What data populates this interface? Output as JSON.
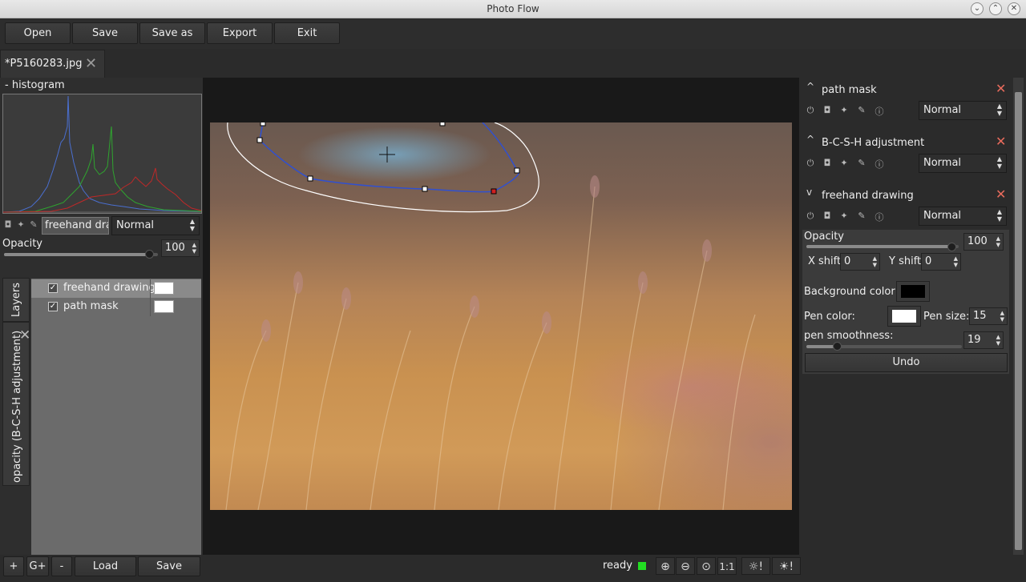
{
  "window": {
    "title": "Photo Flow"
  },
  "toolbar": {
    "open": "Open",
    "save": "Save",
    "save_as": "Save as",
    "export": "Export",
    "exit": "Exit"
  },
  "tab": {
    "label": "*P5160283.jpg"
  },
  "histogram": {
    "header": "- histogram"
  },
  "layer_controls": {
    "name": "freehand drawing",
    "blend": "Normal",
    "opacity_label": "Opacity",
    "opacity_value": "100",
    "opacity_fraction": 0.95
  },
  "side_tabs": {
    "layers": "Layers",
    "opacity": "opacity (B-C-S-H adjustment)"
  },
  "layers": [
    {
      "name": "freehand drawing",
      "checked": true
    },
    {
      "name": "path mask",
      "checked": true
    }
  ],
  "bottom": {
    "add": "+",
    "add_group": "G+",
    "remove": "-",
    "load": "Load",
    "save": "Save",
    "status": "ready",
    "zoom_fit": "1:1",
    "status_color": "#22dd22"
  },
  "right": {
    "layers": [
      {
        "title": "path mask",
        "blend": "Normal",
        "chevron": "^"
      },
      {
        "title": "B-C-S-H adjustment",
        "blend": "Normal",
        "chevron": "^"
      },
      {
        "title": "freehand drawing",
        "blend": "Normal",
        "chevron": "v"
      }
    ],
    "fh": {
      "opacity_label": "Opacity",
      "opacity_value": "100",
      "opacity_fraction": 0.96,
      "xshift_label": "X shift",
      "xshift_value": "0",
      "yshift_label": "Y shift",
      "yshift_value": "0",
      "bg_label": "Background color:",
      "bg_color": "#000000",
      "pen_label": "Pen color:",
      "pen_color": "#ffffff",
      "pen_size_label": "Pen size:",
      "pen_size_value": "15",
      "smooth_label": "pen smoothness:",
      "smooth_value": "19",
      "smooth_fraction": 0.2,
      "undo": "Undo"
    }
  },
  "colors": {
    "close_red": "#e86b5c",
    "accent_blue": "#3050d0"
  }
}
